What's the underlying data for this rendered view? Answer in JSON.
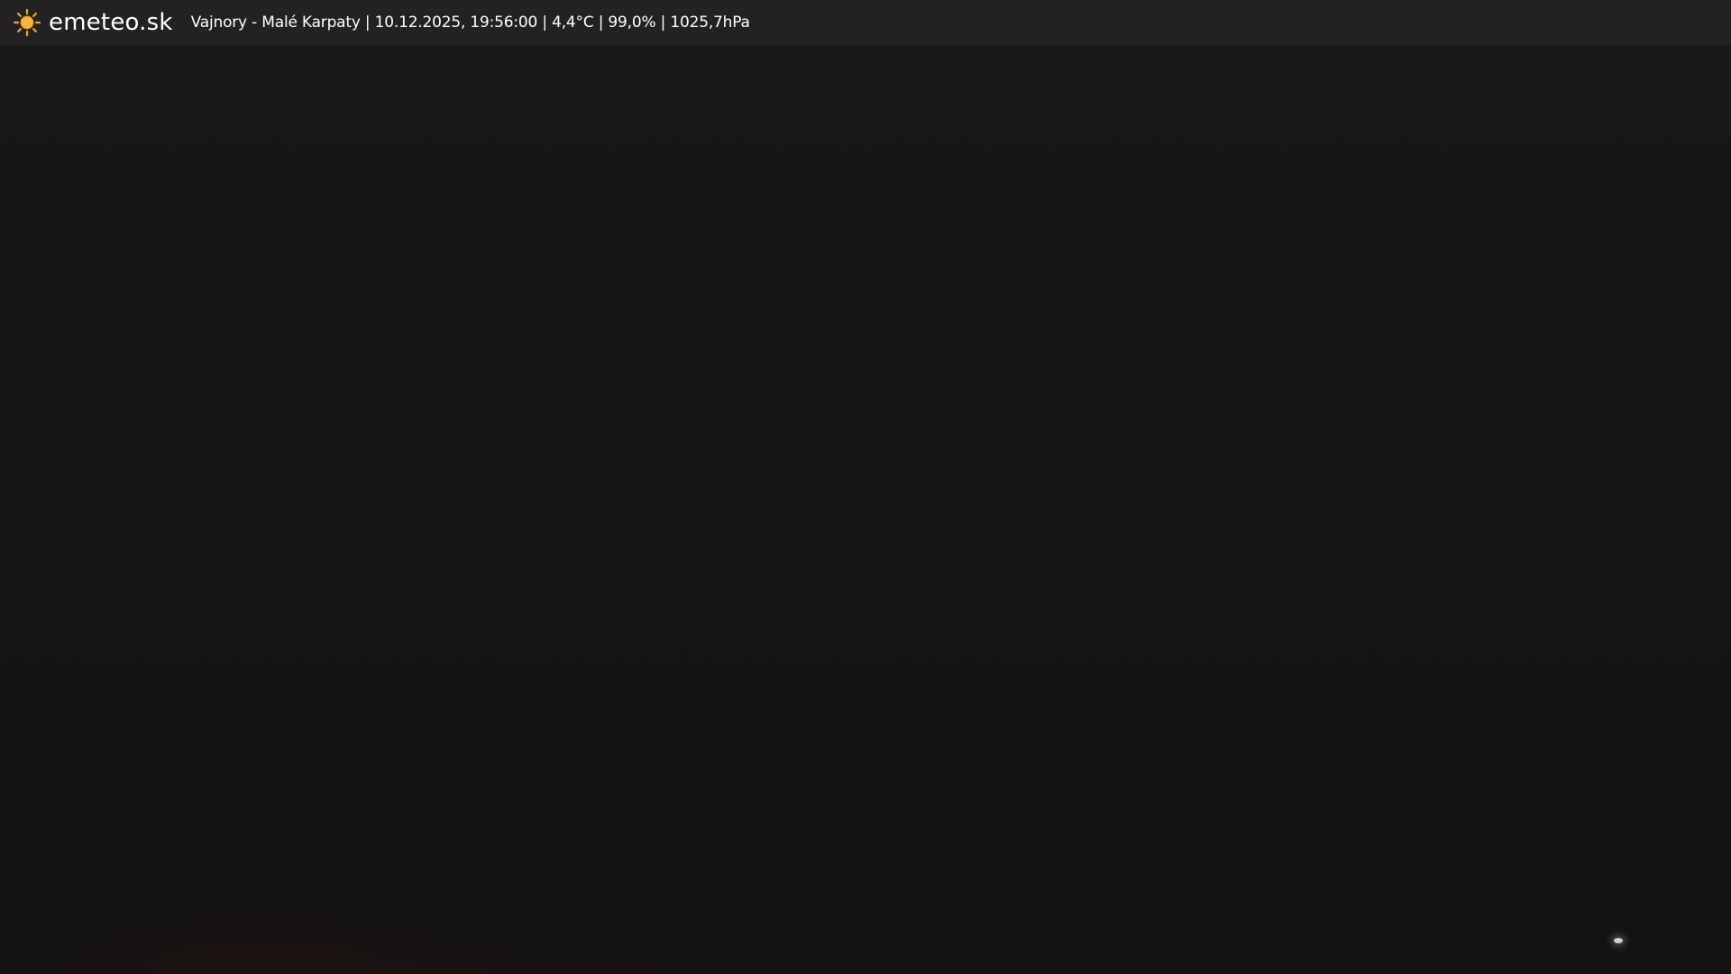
{
  "header": {
    "brand": "emeteo.sk",
    "logo_icon": "sun-icon",
    "info_text": "Vajnory - Malé Karpaty | 10.12.2025, 19:56:00 | 4,4°C | 99,0% | 1025,7hPa"
  },
  "colors": {
    "header_bg": "#222222",
    "sun": "#f5a623",
    "text": "#ffffff"
  }
}
